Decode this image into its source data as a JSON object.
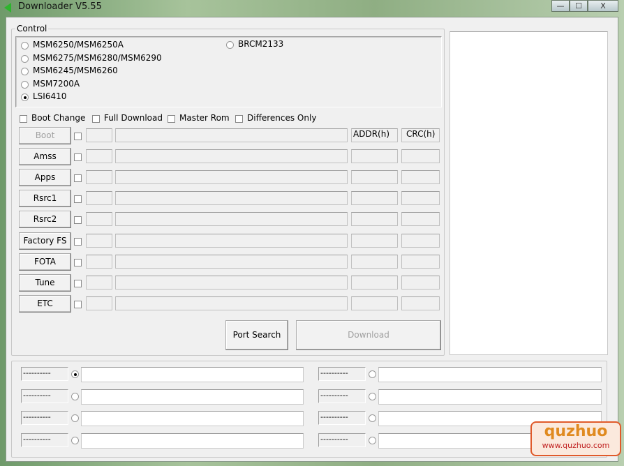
{
  "window": {
    "title": "Downloader V5.55",
    "minimize": "—",
    "maximize": "☐",
    "close": "X"
  },
  "control": {
    "label": "Control",
    "chipsets": [
      {
        "label": "MSM6250/MSM6250A",
        "selected": false
      },
      {
        "label": "MSM6275/MSM6280/MSM6290",
        "selected": false
      },
      {
        "label": "MSM6245/MSM6260",
        "selected": false
      },
      {
        "label": "MSM7200A",
        "selected": false
      },
      {
        "label": "LSI6410",
        "selected": true
      },
      {
        "label": "BRCM2133",
        "selected": false
      }
    ],
    "options": [
      {
        "label": "Boot Change",
        "checked": false
      },
      {
        "label": "Full Download",
        "checked": false
      },
      {
        "label": "Master Rom",
        "checked": false
      },
      {
        "label": "Differences Only",
        "checked": false
      }
    ],
    "addr_header": "ADDR(h)",
    "crc_header": "CRC(h)",
    "images": [
      {
        "label": "Boot",
        "enabled": false
      },
      {
        "label": "Amss",
        "enabled": true
      },
      {
        "label": "Apps",
        "enabled": true
      },
      {
        "label": "Rsrc1",
        "enabled": true
      },
      {
        "label": "Rsrc2",
        "enabled": true
      },
      {
        "label": "Factory FS",
        "enabled": true
      },
      {
        "label": "FOTA",
        "enabled": true
      },
      {
        "label": "Tune",
        "enabled": true
      },
      {
        "label": "ETC",
        "enabled": true
      }
    ],
    "port_search": "Port Search",
    "download": "Download"
  },
  "ports": [
    {
      "label": "----------",
      "selected": true,
      "value": ""
    },
    {
      "label": "----------",
      "selected": false,
      "value": ""
    },
    {
      "label": "----------",
      "selected": false,
      "value": ""
    },
    {
      "label": "----------",
      "selected": false,
      "value": ""
    },
    {
      "label": "----------",
      "selected": false,
      "value": ""
    },
    {
      "label": "----------",
      "selected": false,
      "value": ""
    },
    {
      "label": "----------",
      "selected": false,
      "value": ""
    },
    {
      "label": "----------",
      "selected": false,
      "value": ""
    }
  ],
  "watermark": {
    "brand": "quzhuo",
    "url": "www.quzhuo.com"
  }
}
